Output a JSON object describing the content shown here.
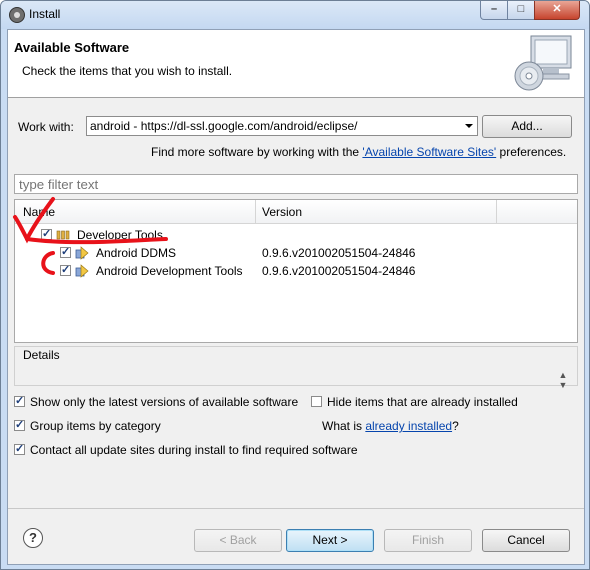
{
  "window": {
    "title": "Install",
    "controls": {
      "minimize_icon": "minimize-icon",
      "maximize_icon": "maximize-icon",
      "close_icon": "close-icon"
    }
  },
  "banner": {
    "title": "Available Software",
    "subtitle": "Check the items that you wish to install.",
    "icon": "computer-disc-icon"
  },
  "work_with": {
    "label": "Work with:",
    "value": "android - https://dl-ssl.google.com/android/eclipse/",
    "add_label": "Add..."
  },
  "find_more": {
    "prefix": "Find more software by working with the ",
    "link": "'Available Software Sites'",
    "suffix": " preferences."
  },
  "filter": {
    "placeholder": "type filter text"
  },
  "tree": {
    "columns": [
      "Name",
      "Version"
    ],
    "items": [
      {
        "label": "Developer Tools",
        "version": "",
        "checked": true,
        "level": 0
      },
      {
        "label": "Android DDMS",
        "version": "0.9.6.v201002051504-24846",
        "checked": true,
        "level": 1
      },
      {
        "label": "Android Development Tools",
        "version": "0.9.6.v201002051504-24846",
        "checked": true,
        "level": 1
      }
    ]
  },
  "details": {
    "label": "Details"
  },
  "options": {
    "show_latest": {
      "label": "Show only the latest versions of available software",
      "checked": true
    },
    "hide_installed": {
      "label": "Hide items that are already installed",
      "checked": false
    },
    "group_by_category": {
      "label": "Group items by category",
      "checked": true
    },
    "what_is_prefix": "What is ",
    "what_is_link": "already installed",
    "what_is_suffix": "?",
    "contact_sites": {
      "label": "Contact all update sites during install to find required software",
      "checked": true
    }
  },
  "buttons": {
    "help_symbol": "?",
    "back": "< Back",
    "next": "Next >",
    "finish": "Finish",
    "cancel": "Cancel"
  },
  "colors": {
    "annotation": "#e8121a",
    "link": "#0645ad"
  }
}
